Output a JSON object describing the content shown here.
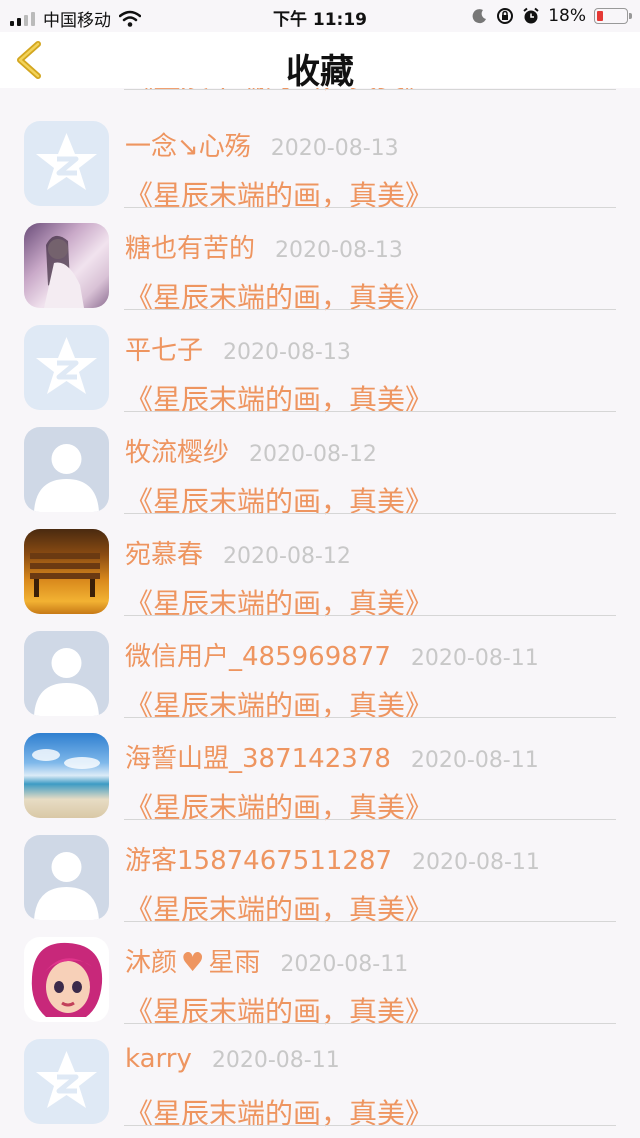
{
  "status_bar": {
    "carrier": "中国移动",
    "time": "下午 11:19",
    "battery": "18%"
  },
  "nav": {
    "title": "收藏"
  },
  "rows": [
    {
      "name": "",
      "date": "",
      "comment": "《星辰末端的画，真美》",
      "avatar": "anime-girl"
    },
    {
      "name": "一念↘心殇",
      "date": "2020-08-13",
      "comment": "《星辰末端的画，真美》",
      "avatar": "qq-star"
    },
    {
      "name": "糖也有苦的",
      "date": "2020-08-13",
      "comment": "《星辰末端的画，真美》",
      "avatar": "anime-girl"
    },
    {
      "name": "平七子",
      "date": "2020-08-13",
      "comment": "《星辰末端的画，真美》",
      "avatar": "qq-star"
    },
    {
      "name": "牧流樱纱",
      "date": "2020-08-12",
      "comment": "《星辰末端的画，真美》",
      "avatar": "default-person"
    },
    {
      "name": "宛慕春",
      "date": "2020-08-12",
      "comment": "《星辰末端的画，真美》",
      "avatar": "autumn-bench"
    },
    {
      "name": "微信用户_485969877",
      "date": "2020-08-11",
      "comment": "《星辰末端的画，真美》",
      "avatar": "default-person"
    },
    {
      "name": "海誓山盟_387142378",
      "date": "2020-08-11",
      "comment": "《星辰末端的画，真美》",
      "avatar": "beach"
    },
    {
      "name": "游客1587467511287",
      "date": "2020-08-11",
      "comment": "《星辰末端的画，真美》",
      "avatar": "default-person"
    },
    {
      "name_parts": [
        "沐颜",
        "星雨"
      ],
      "date": "2020-08-11",
      "comment": "《星辰末端的画，真美》",
      "avatar": "cartoon-girl"
    },
    {
      "name": "karry",
      "date": "2020-08-11",
      "comment": "《星辰末端的画，真美》",
      "avatar": "qq-star"
    }
  ],
  "colors": {
    "accent": "#ee9560",
    "date": "#c8c8c8",
    "background": "#f8f6f9"
  }
}
